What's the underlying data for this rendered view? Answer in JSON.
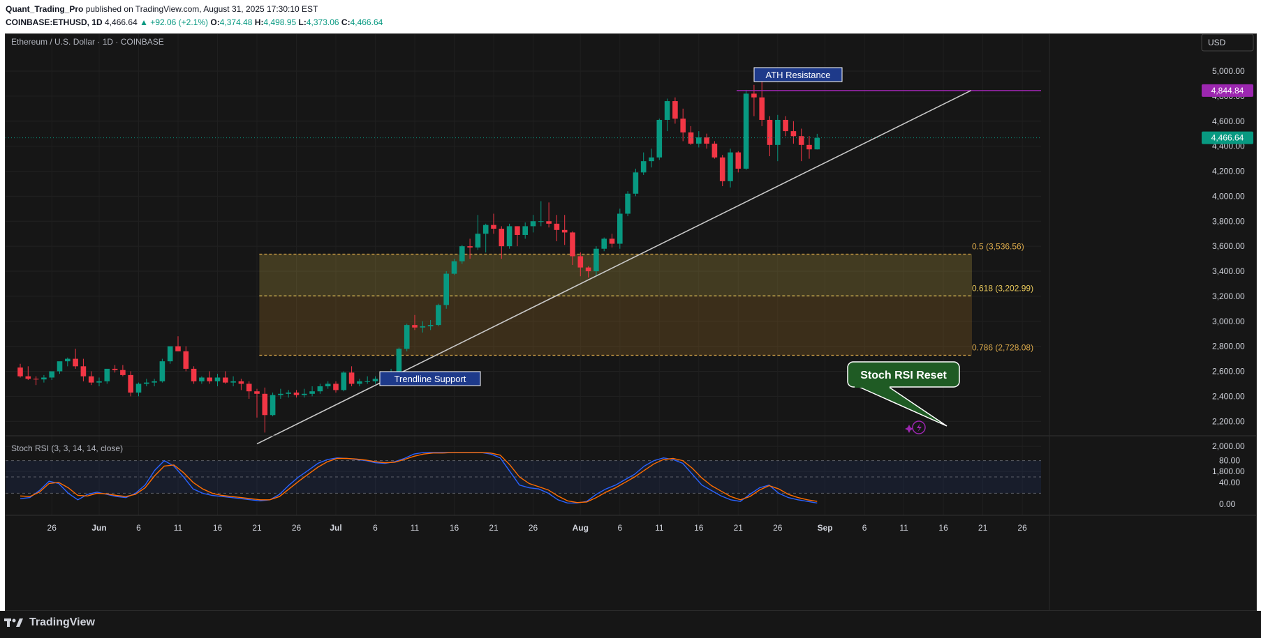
{
  "header": {
    "author": "Quant_Trading_Pro",
    "published": "published on TradingView.com, August 31, 2025 17:30:10 EST",
    "symbol": "COINBASE:ETHUSD, 1D",
    "last": "4,466.64",
    "change": "▲ +92.06 (+2.1%)",
    "o_label": "O:",
    "o": "4,374.48",
    "h_label": "H:",
    "h": "4,498.95",
    "l_label": "L:",
    "l": "4,373.06",
    "c_label": "C:",
    "c": "4,466.64"
  },
  "chart": {
    "title": "Ethereum / U.S. Dollar · 1D · COINBASE",
    "currency": "USD",
    "price_ticks": [
      "5,000.00",
      "4,800.00",
      "4,600.00",
      "4,400.00",
      "4,200.00",
      "4,000.00",
      "3,800.00",
      "3,600.00",
      "3,400.00",
      "3,200.00",
      "3,000.00",
      "2,800.00",
      "2,600.00",
      "2,400.00",
      "2,200.00",
      "2,000.00",
      "1,800.00"
    ],
    "price_tick_values": [
      5000,
      4800,
      4600,
      4400,
      4200,
      4000,
      3800,
      3600,
      3400,
      3200,
      3000,
      2800,
      2600,
      2400,
      2200,
      2000,
      1800
    ],
    "ath_label": "4,844.84",
    "ath_value": 4844.84,
    "last_label": "4,466.64",
    "last_value": 4466.64,
    "annotations": {
      "ath": "ATH Resistance",
      "trend": "Trendline Support",
      "stoch": "Stoch RSI Reset"
    },
    "fib": [
      {
        "label": "0.5 (3,536.56)",
        "value": 3536.56,
        "color": "#d9a84a"
      },
      {
        "label": "0.618 (3,202.99)",
        "value": 3202.99,
        "color": "#e7c75a"
      },
      {
        "label": "0.786 (2,728.08)",
        "value": 2728.08,
        "color": "#d9a84a"
      }
    ],
    "date_labels": [
      "26",
      "Jun",
      "6",
      "11",
      "16",
      "21",
      "26",
      "Jul",
      "6",
      "11",
      "16",
      "21",
      "26",
      "Aug",
      "6",
      "11",
      "16",
      "21",
      "26",
      "Sep",
      "6",
      "11",
      "16",
      "21",
      "26"
    ],
    "colors": {
      "up": "#089981",
      "down": "#f23645",
      "ath": "#9c27b0",
      "trend": "#c8c8c8",
      "fibzone": "#d9a84a"
    }
  },
  "stoch": {
    "title": "Stoch RSI (3, 3, 14, 14, close)",
    "ticks": [
      "80.00",
      "40.00",
      "0.00"
    ],
    "tick_values": [
      80,
      40,
      0
    ]
  },
  "footer": {
    "brand": "TradingView"
  },
  "chart_data": {
    "type": "candlestick",
    "title": "Ethereum / U.S. Dollar · 1D · COINBASE",
    "ylabel": "USD",
    "ylim": [
      1700,
      5180
    ],
    "dates": [
      "2025-05-22",
      "2025-05-23",
      "2025-05-24",
      "2025-05-25",
      "2025-05-26",
      "2025-05-27",
      "2025-05-28",
      "2025-05-29",
      "2025-05-30",
      "2025-05-31",
      "2025-06-01",
      "2025-06-02",
      "2025-06-03",
      "2025-06-04",
      "2025-06-05",
      "2025-06-06",
      "2025-06-07",
      "2025-06-08",
      "2025-06-09",
      "2025-06-10",
      "2025-06-11",
      "2025-06-12",
      "2025-06-13",
      "2025-06-14",
      "2025-06-15",
      "2025-06-16",
      "2025-06-17",
      "2025-06-18",
      "2025-06-19",
      "2025-06-20",
      "2025-06-21",
      "2025-06-22",
      "2025-06-23",
      "2025-06-24",
      "2025-06-25",
      "2025-06-26",
      "2025-06-27",
      "2025-06-28",
      "2025-06-29",
      "2025-06-30",
      "2025-07-01",
      "2025-07-02",
      "2025-07-03",
      "2025-07-04",
      "2025-07-05",
      "2025-07-06",
      "2025-07-07",
      "2025-07-08",
      "2025-07-09",
      "2025-07-10",
      "2025-07-11",
      "2025-07-12",
      "2025-07-13",
      "2025-07-14",
      "2025-07-15",
      "2025-07-16",
      "2025-07-17",
      "2025-07-18",
      "2025-07-19",
      "2025-07-20",
      "2025-07-21",
      "2025-07-22",
      "2025-07-23",
      "2025-07-24",
      "2025-07-25",
      "2025-07-26",
      "2025-07-27",
      "2025-07-28",
      "2025-07-29",
      "2025-07-30",
      "2025-07-31",
      "2025-08-01",
      "2025-08-02",
      "2025-08-03",
      "2025-08-04",
      "2025-08-05",
      "2025-08-06",
      "2025-08-07",
      "2025-08-08",
      "2025-08-09",
      "2025-08-10",
      "2025-08-11",
      "2025-08-12",
      "2025-08-13",
      "2025-08-14",
      "2025-08-15",
      "2025-08-16",
      "2025-08-17",
      "2025-08-18",
      "2025-08-19",
      "2025-08-20",
      "2025-08-21",
      "2025-08-22",
      "2025-08-23",
      "2025-08-24",
      "2025-08-25",
      "2025-08-26",
      "2025-08-27",
      "2025-08-28",
      "2025-08-29",
      "2025-08-30",
      "2025-08-31"
    ],
    "open": [
      2630,
      2560,
      2540,
      2535,
      2550,
      2600,
      2680,
      2700,
      2640,
      2560,
      2510,
      2520,
      2620,
      2610,
      2570,
      2430,
      2500,
      2510,
      2520,
      2680,
      2800,
      2760,
      2620,
      2520,
      2550,
      2520,
      2550,
      2510,
      2520,
      2500,
      2440,
      2420,
      2250,
      2410,
      2420,
      2430,
      2410,
      2420,
      2440,
      2480,
      2500,
      2450,
      2590,
      2500,
      2520,
      2520,
      2540,
      2570,
      2600,
      2780,
      2970,
      2950,
      2960,
      2970,
      3130,
      3380,
      3480,
      3600,
      3590,
      3700,
      3770,
      3740,
      3600,
      3760,
      3690,
      3760,
      3800,
      3800,
      3780,
      3730,
      3710,
      3520,
      3430,
      3400,
      3580,
      3660,
      3620,
      3860,
      4020,
      4190,
      4280,
      4310,
      4610,
      4760,
      4620,
      4510,
      4420,
      4470,
      4420,
      4310,
      4120,
      4350,
      4220,
      4820,
      4790,
      4610,
      4410,
      4610,
      4520,
      4480,
      4410,
      4374.48
    ],
    "high": [
      2660,
      2640,
      2560,
      2570,
      2580,
      2660,
      2710,
      2780,
      2700,
      2600,
      2550,
      2560,
      2650,
      2650,
      2600,
      2510,
      2540,
      2540,
      2700,
      2790,
      2880,
      2800,
      2640,
      2560,
      2600,
      2580,
      2600,
      2560,
      2540,
      2520,
      2460,
      2470,
      2430,
      2460,
      2450,
      2450,
      2460,
      2480,
      2500,
      2520,
      2520,
      2600,
      2640,
      2540,
      2560,
      2560,
      2590,
      2620,
      2790,
      2980,
      3050,
      3000,
      3010,
      3140,
      3400,
      3500,
      3610,
      3660,
      3850,
      3780,
      3860,
      3760,
      3780,
      3760,
      3790,
      3850,
      3960,
      3950,
      3850,
      3850,
      3720,
      3550,
      3440,
      3600,
      3670,
      3700,
      3900,
      4040,
      4220,
      4350,
      4380,
      4620,
      4780,
      4790,
      4700,
      4560,
      4520,
      4500,
      4440,
      4330,
      4380,
      4360,
      4850,
      4890,
      4960,
      4640,
      4650,
      4640,
      4600,
      4540,
      4480,
      4498.95
    ],
    "low": [
      2550,
      2530,
      2490,
      2510,
      2530,
      2580,
      2640,
      2620,
      2520,
      2490,
      2480,
      2500,
      2590,
      2560,
      2400,
      2400,
      2480,
      2480,
      2510,
      2660,
      2760,
      2600,
      2500,
      2500,
      2500,
      2480,
      2500,
      2480,
      2450,
      2380,
      2230,
      2110,
      2240,
      2380,
      2390,
      2390,
      2390,
      2400,
      2420,
      2460,
      2430,
      2440,
      2480,
      2480,
      2500,
      2500,
      2520,
      2550,
      2580,
      2760,
      2930,
      2910,
      2930,
      2960,
      3100,
      3370,
      3460,
      3500,
      3570,
      3550,
      3700,
      3500,
      3580,
      3600,
      3660,
      3710,
      3760,
      3750,
      3640,
      3610,
      3450,
      3360,
      3350,
      3360,
      3560,
      3590,
      3580,
      3840,
      4000,
      4170,
      4230,
      4290,
      4520,
      4580,
      4440,
      4410,
      4390,
      4380,
      4300,
      4080,
      4070,
      4190,
      4210,
      4640,
      4560,
      4320,
      4280,
      4480,
      4420,
      4280,
      4300,
      4373.06
    ],
    "close": [
      2560,
      2540,
      2535,
      2550,
      2600,
      2680,
      2700,
      2640,
      2560,
      2510,
      2520,
      2620,
      2610,
      2570,
      2430,
      2500,
      2510,
      2520,
      2680,
      2800,
      2760,
      2620,
      2520,
      2550,
      2520,
      2550,
      2510,
      2520,
      2500,
      2440,
      2420,
      2250,
      2410,
      2420,
      2430,
      2410,
      2420,
      2440,
      2480,
      2500,
      2450,
      2590,
      2500,
      2520,
      2520,
      2540,
      2570,
      2600,
      2780,
      2970,
      2950,
      2960,
      2970,
      3130,
      3380,
      3480,
      3600,
      3590,
      3700,
      3770,
      3740,
      3600,
      3760,
      3690,
      3760,
      3800,
      3800,
      3780,
      3730,
      3710,
      3520,
      3430,
      3400,
      3580,
      3660,
      3620,
      3860,
      4020,
      4190,
      4280,
      4310,
      4610,
      4760,
      4620,
      4510,
      4420,
      4470,
      4420,
      4310,
      4120,
      4350,
      4220,
      4820,
      4790,
      4610,
      4410,
      4610,
      4520,
      4480,
      4410,
      4374.48,
      4466.64
    ],
    "stoch_k": [
      10,
      12,
      25,
      42,
      38,
      20,
      8,
      18,
      22,
      18,
      14,
      12,
      20,
      35,
      62,
      80,
      70,
      50,
      28,
      20,
      16,
      14,
      12,
      10,
      8,
      6,
      8,
      18,
      35,
      50,
      62,
      75,
      82,
      85,
      84,
      82,
      80,
      76,
      75,
      78,
      84,
      92,
      95,
      95,
      95,
      95,
      95,
      95,
      95,
      92,
      85,
      60,
      35,
      30,
      28,
      20,
      8,
      2,
      2,
      5,
      18,
      28,
      35,
      45,
      55,
      70,
      80,
      85,
      82,
      75,
      55,
      35,
      25,
      15,
      8,
      5,
      18,
      30,
      35,
      20,
      12,
      8,
      5,
      2
    ],
    "stoch_d": [
      15,
      14,
      22,
      38,
      40,
      30,
      16,
      15,
      20,
      19,
      16,
      14,
      18,
      30,
      52,
      70,
      72,
      58,
      40,
      28,
      20,
      16,
      14,
      12,
      10,
      8,
      8,
      14,
      28,
      42,
      55,
      68,
      78,
      84,
      84,
      83,
      81,
      78,
      76,
      77,
      82,
      88,
      92,
      94,
      94,
      95,
      95,
      95,
      95,
      94,
      90,
      72,
      50,
      38,
      32,
      26,
      15,
      6,
      3,
      4,
      12,
      22,
      30,
      40,
      50,
      62,
      74,
      82,
      84,
      80,
      66,
      48,
      34,
      24,
      14,
      8,
      14,
      26,
      34,
      28,
      18,
      12,
      8,
      5
    ]
  }
}
